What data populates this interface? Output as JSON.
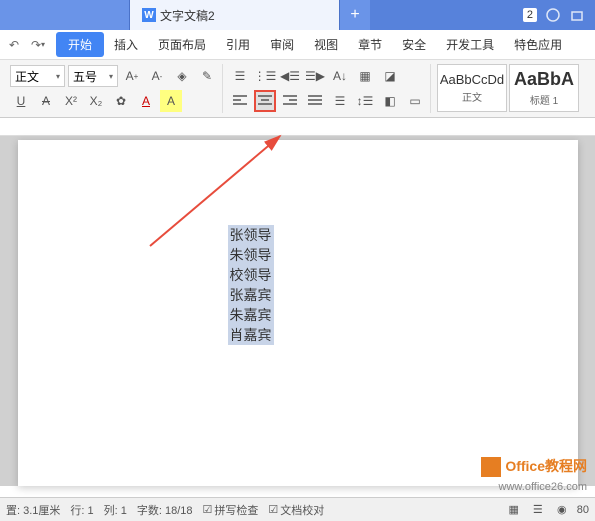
{
  "titlebar": {
    "tab1_label": "",
    "tab2_label": "文字文稿2",
    "plus": "+",
    "badge": "2"
  },
  "menubar": {
    "undo": "↶",
    "redo": "↷",
    "items": [
      "开始",
      "插入",
      "页面布局",
      "引用",
      "审阅",
      "视图",
      "章节",
      "安全",
      "开发工具",
      "特色应用"
    ]
  },
  "ribbon": {
    "font_style": "正文",
    "font_size": "五号",
    "styles": [
      {
        "preview": "AaBbCcDd",
        "name": "正文"
      },
      {
        "preview": "AaBbA",
        "name": "标题 1"
      }
    ]
  },
  "document": {
    "lines": [
      "张领导",
      "朱领导",
      "校领导",
      "张嘉宾",
      "朱嘉宾",
      "肖嘉宾"
    ]
  },
  "statusbar": {
    "position": "置: 3.1厘米",
    "line": "行: 1",
    "column": "列: 1",
    "wordcount": "字数: 18/18",
    "spellcheck": "拼写检查",
    "doccheck": "文档校对",
    "zoom": "80"
  },
  "watermark": {
    "title": "Office教程网",
    "url": "www.office26.com"
  }
}
